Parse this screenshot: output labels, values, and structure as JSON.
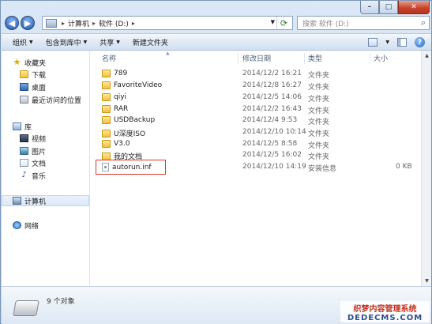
{
  "address": {
    "crumbs": [
      "计算机",
      "软件 (D:)"
    ],
    "search_placeholder": "搜索 软件 (D:)"
  },
  "toolbar": {
    "organize": "组织",
    "include_in_library": "包含到库中",
    "share": "共享",
    "new_folder": "新建文件夹"
  },
  "nav": {
    "favorites": "收藏夹",
    "downloads": "下载",
    "desktop": "桌面",
    "recent": "最近访问的位置",
    "libraries": "库",
    "videos": "视频",
    "pictures": "图片",
    "documents": "文档",
    "music": "音乐",
    "computer": "计算机",
    "network": "网络"
  },
  "columns": {
    "name": "名称",
    "date": "修改日期",
    "type": "类型",
    "size": "大小"
  },
  "files": [
    {
      "name": "789",
      "date": "2014/12/2 16:21",
      "type": "文件夹",
      "size": ""
    },
    {
      "name": "FavoriteVideo",
      "date": "2014/12/8 16:27",
      "type": "文件夹",
      "size": ""
    },
    {
      "name": "qiyi",
      "date": "2014/12/5 14:06",
      "type": "文件夹",
      "size": ""
    },
    {
      "name": "RAR",
      "date": "2014/12/2 16:43",
      "type": "文件夹",
      "size": ""
    },
    {
      "name": "USDBackup",
      "date": "2014/12/4 9:53",
      "type": "文件夹",
      "size": ""
    },
    {
      "name": "U深度ISO",
      "date": "2014/12/10 10:14",
      "type": "文件夹",
      "size": ""
    },
    {
      "name": "V3.0",
      "date": "2014/12/5 8:58",
      "type": "文件夹",
      "size": ""
    },
    {
      "name": "我的文档",
      "date": "2014/12/5 16:02",
      "type": "文件夹",
      "size": ""
    },
    {
      "name": "autorun.inf",
      "date": "2014/12/10 14:19",
      "type": "安装信息",
      "size": "0 KB"
    }
  ],
  "status": {
    "item_count": "9 个对象"
  },
  "watermark": {
    "line1": "织梦内容管理系统",
    "line2": "DEDECMS.COM"
  },
  "colors": {
    "highlight_border": "#d93a2f",
    "folder": "#f0c13a",
    "window_chrome": "#c8dbf0"
  }
}
